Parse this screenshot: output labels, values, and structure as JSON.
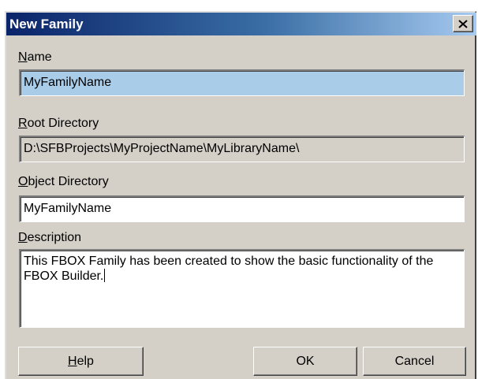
{
  "dialog": {
    "title": "New Family",
    "close_glyph": "✕"
  },
  "name_field": {
    "label_mnemonic": "N",
    "label_rest": "ame",
    "value": "MyFamilyName"
  },
  "root_directory": {
    "label_mnemonic": "R",
    "label_rest": "oot Directory",
    "value": "D:\\SFBProjects\\MyProjectName\\MyLibraryName\\"
  },
  "object_directory": {
    "label_mnemonic": "O",
    "label_rest": "bject Directory",
    "value": "MyFamilyName"
  },
  "description": {
    "label_mnemonic": "D",
    "label_rest": "escription",
    "value": "This FBOX Family has been created to show the basic functionality of the FBOX Builder."
  },
  "buttons": {
    "help_mnemonic": "H",
    "help_rest": "elp",
    "ok": "OK",
    "cancel": "Cancel"
  },
  "colors": {
    "title_bar_start": "#0a246a",
    "title_bar_end": "#a6caf0",
    "dialog_face": "#d4d0c8",
    "name_field_highlight": "#a9cde9"
  },
  "icons": {
    "close": "close-icon"
  }
}
